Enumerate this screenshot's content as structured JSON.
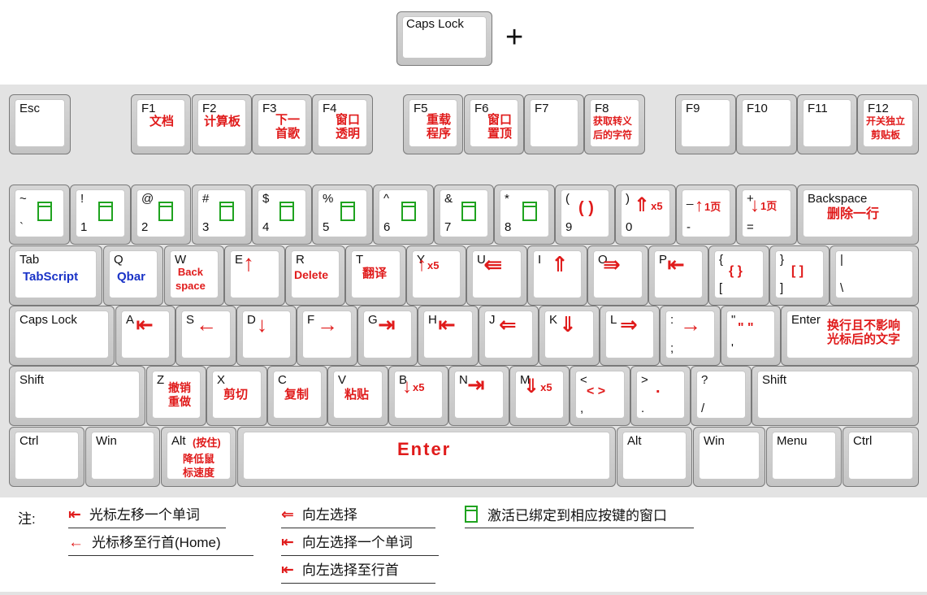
{
  "top_key": {
    "label": "Caps Lock",
    "plus": "+"
  },
  "window_icon_color": "#1fa31f",
  "action_color": "#e01b1b",
  "script_color": "#1a33c7",
  "keys": [
    {
      "id": "esc",
      "label": "Esc"
    },
    {
      "id": "f1",
      "label": "F1",
      "action": "文档"
    },
    {
      "id": "f2",
      "label": "F2",
      "action": "计算板"
    },
    {
      "id": "f3",
      "label": "F3",
      "action": "下一\n首歌"
    },
    {
      "id": "f4",
      "label": "F4",
      "action": "窗口\n透明"
    },
    {
      "id": "f5",
      "label": "F5",
      "action": "重载\n程序"
    },
    {
      "id": "f6",
      "label": "F6",
      "action": "窗口\n置顶"
    },
    {
      "id": "f7",
      "label": "F7"
    },
    {
      "id": "f8",
      "label": "F8",
      "action": "获取转义\n后的字符"
    },
    {
      "id": "f9",
      "label": "F9"
    },
    {
      "id": "f10",
      "label": "F10"
    },
    {
      "id": "f11",
      "label": "F11"
    },
    {
      "id": "f12",
      "label": "F12",
      "action": "开关独立\n剪贴板"
    },
    {
      "id": "tilde",
      "label": "~",
      "label2": "`",
      "icon": "window-icon"
    },
    {
      "id": "k1",
      "label": "!",
      "label2": "1",
      "icon": "window-icon"
    },
    {
      "id": "k2",
      "label": "@",
      "label2": "2",
      "icon": "window-icon"
    },
    {
      "id": "k3",
      "label": "#",
      "label2": "3",
      "icon": "window-icon"
    },
    {
      "id": "k4",
      "label": "$",
      "label2": "4",
      "icon": "window-icon"
    },
    {
      "id": "k5",
      "label": "%",
      "label2": "5",
      "icon": "window-icon"
    },
    {
      "id": "k6",
      "label": "^",
      "label2": "6",
      "icon": "window-icon"
    },
    {
      "id": "k7",
      "label": "&",
      "label2": "7",
      "icon": "window-icon"
    },
    {
      "id": "k8",
      "label": "*",
      "label2": "8",
      "icon": "window-icon"
    },
    {
      "id": "k9",
      "label": "(",
      "label2": "9",
      "action": "( )"
    },
    {
      "id": "k0",
      "label": ")",
      "label2": "0",
      "action": "⇑",
      "extra": "x5"
    },
    {
      "id": "minus",
      "label": "_",
      "label2": "-",
      "action": "↑",
      "extra": "1页"
    },
    {
      "id": "equal",
      "label": "+",
      "label2": "=",
      "action": "↓",
      "extra": "1页"
    },
    {
      "id": "backspace",
      "label": "Backspace",
      "action": "删除一行"
    },
    {
      "id": "tab",
      "label": "Tab",
      "action": "TabScript",
      "blue": true
    },
    {
      "id": "q",
      "label": "Q",
      "action": "Qbar",
      "blue": true
    },
    {
      "id": "w",
      "label": "W",
      "action": "Back\nspace"
    },
    {
      "id": "e",
      "label": "E",
      "action": "↑"
    },
    {
      "id": "r",
      "label": "R",
      "action": "Delete"
    },
    {
      "id": "t",
      "label": "T",
      "action": "翻译"
    },
    {
      "id": "y",
      "label": "Y",
      "action": "↑",
      "extra": "x5"
    },
    {
      "id": "u",
      "label": "U",
      "action": "⇚"
    },
    {
      "id": "i",
      "label": "I",
      "action": "⇑"
    },
    {
      "id": "o",
      "label": "O",
      "action": "⇛"
    },
    {
      "id": "p",
      "label": "P",
      "action": "⇤"
    },
    {
      "id": "lbrace",
      "label": "{",
      "label2": "[",
      "action": "{ }"
    },
    {
      "id": "rbrace",
      "label": "}",
      "label2": "]",
      "action": "[ ]"
    },
    {
      "id": "pipe",
      "label": "|",
      "label2": "\\"
    },
    {
      "id": "capslock",
      "label": "Caps Lock"
    },
    {
      "id": "a",
      "label": "A",
      "action": "⇤"
    },
    {
      "id": "s",
      "label": "S",
      "action": "←"
    },
    {
      "id": "d",
      "label": "D",
      "action": "↓"
    },
    {
      "id": "f",
      "label": "F",
      "action": "→"
    },
    {
      "id": "g",
      "label": "G",
      "action": "⇥"
    },
    {
      "id": "h",
      "label": "H",
      "action": "⇤"
    },
    {
      "id": "j",
      "label": "J",
      "action": "⇐"
    },
    {
      "id": "k",
      "label": "K",
      "action": "⇓"
    },
    {
      "id": "l",
      "label": "L",
      "action": "⇒"
    },
    {
      "id": "semicolon",
      "label": ":",
      "label2": ";",
      "action": "→"
    },
    {
      "id": "quote",
      "label": "\"",
      "label2": "'",
      "action": "\" \""
    },
    {
      "id": "enter",
      "label": "Enter",
      "action": "换行且不影响\n光标后的文字"
    },
    {
      "id": "lshift",
      "label": "Shift"
    },
    {
      "id": "z",
      "label": "Z",
      "action": "撤销\n重做"
    },
    {
      "id": "x",
      "label": "X",
      "action": "剪切"
    },
    {
      "id": "c",
      "label": "C",
      "action": "复制"
    },
    {
      "id": "v",
      "label": "V",
      "action": "粘贴"
    },
    {
      "id": "b",
      "label": "B",
      "action": "↓",
      "extra": "x5"
    },
    {
      "id": "n",
      "label": "N",
      "action": "⇥"
    },
    {
      "id": "m",
      "label": "M",
      "action": "⇓",
      "extra": "x5"
    },
    {
      "id": "comma",
      "label": "<",
      "label2": ",",
      "action": "< >"
    },
    {
      "id": "period",
      "label": ">",
      "label2": ".",
      "action": "."
    },
    {
      "id": "slash",
      "label": "?",
      "label2": "/"
    },
    {
      "id": "rshift",
      "label": "Shift"
    },
    {
      "id": "lctrl",
      "label": "Ctrl"
    },
    {
      "id": "lwin",
      "label": "Win"
    },
    {
      "id": "lalt",
      "label": "Alt",
      "action_top": "(按住)",
      "action": "降低鼠\n标速度"
    },
    {
      "id": "space",
      "action": "Enter"
    },
    {
      "id": "ralt",
      "label": "Alt"
    },
    {
      "id": "rwin",
      "label": "Win"
    },
    {
      "id": "menu",
      "label": "Menu"
    },
    {
      "id": "rctrl",
      "label": "Ctrl"
    }
  ],
  "legend": {
    "note": "注:",
    "items": [
      {
        "symbol": "⇤",
        "text": "光标左移一个单词"
      },
      {
        "symbol": "⇤",
        "text": "光标移至行首(Home)"
      },
      {
        "symbol": "⇐",
        "text": "向左选择"
      },
      {
        "symbol": "⇤",
        "text": "向左选择一个单词"
      },
      {
        "symbol": "⇤",
        "text": "向左选择至行首"
      },
      {
        "symbol": "window-icon",
        "text": "激活已绑定到相应按键的窗口"
      }
    ]
  }
}
